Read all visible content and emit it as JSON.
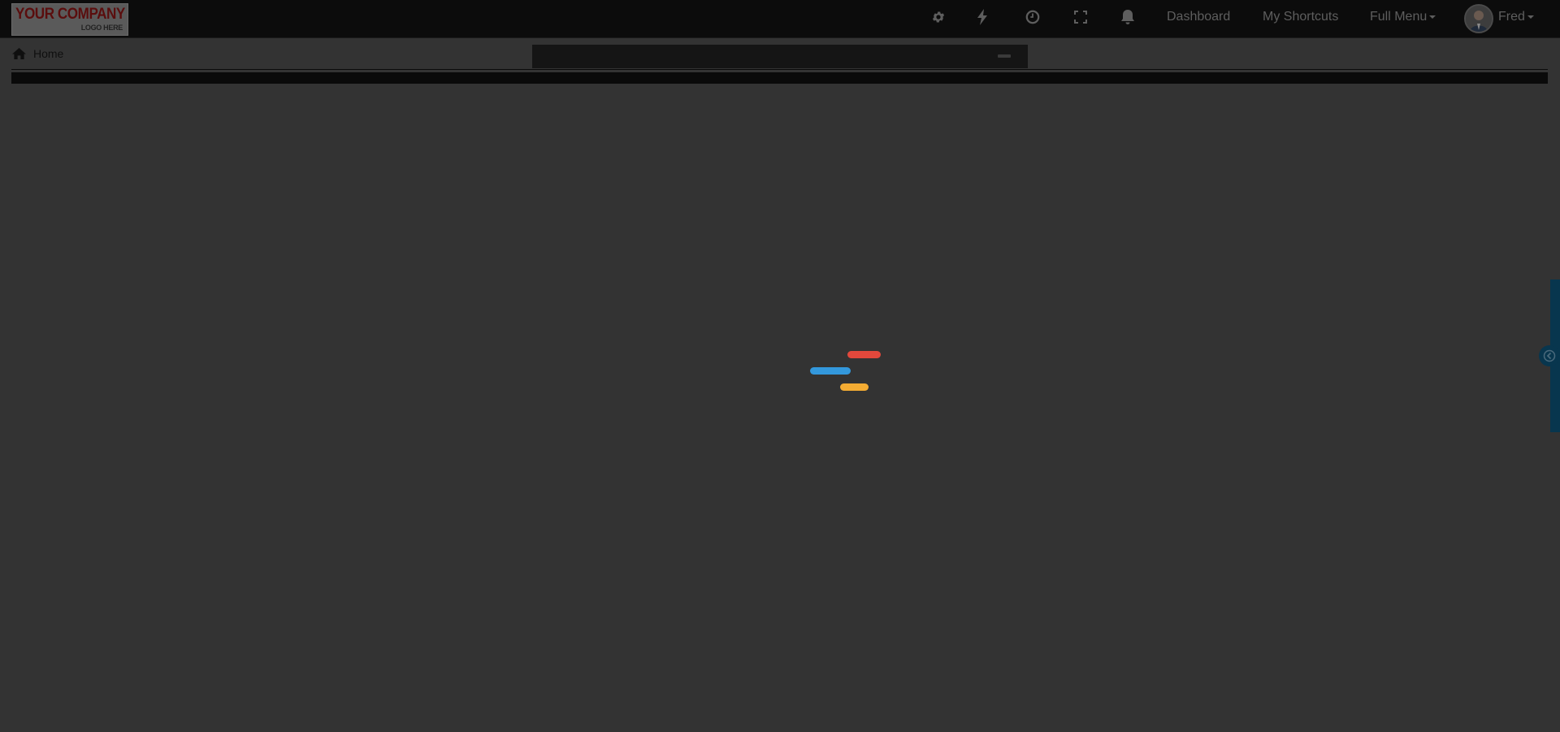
{
  "logo": {
    "main_text": "YOUR COMPANY",
    "sub_text": "LOGO HERE"
  },
  "topbar": {
    "icons": [
      "gear-icon",
      "bolt-icon",
      "clock-icon",
      "expand-icon",
      "bell-icon"
    ],
    "links": {
      "dashboard": "Dashboard",
      "shortcuts": "My Shortcuts",
      "full_menu": "Full Menu"
    },
    "user": {
      "name": "Fred"
    }
  },
  "breadcrumb": {
    "home_label": "Home"
  },
  "loader": {
    "colors": {
      "red": "#e2483c",
      "blue": "#3398dc",
      "yellow": "#f4ac33"
    }
  },
  "colors": {
    "overlay_background": "#333333",
    "topbar_background": "#0c0c0c",
    "side_panel": "#08364e"
  }
}
